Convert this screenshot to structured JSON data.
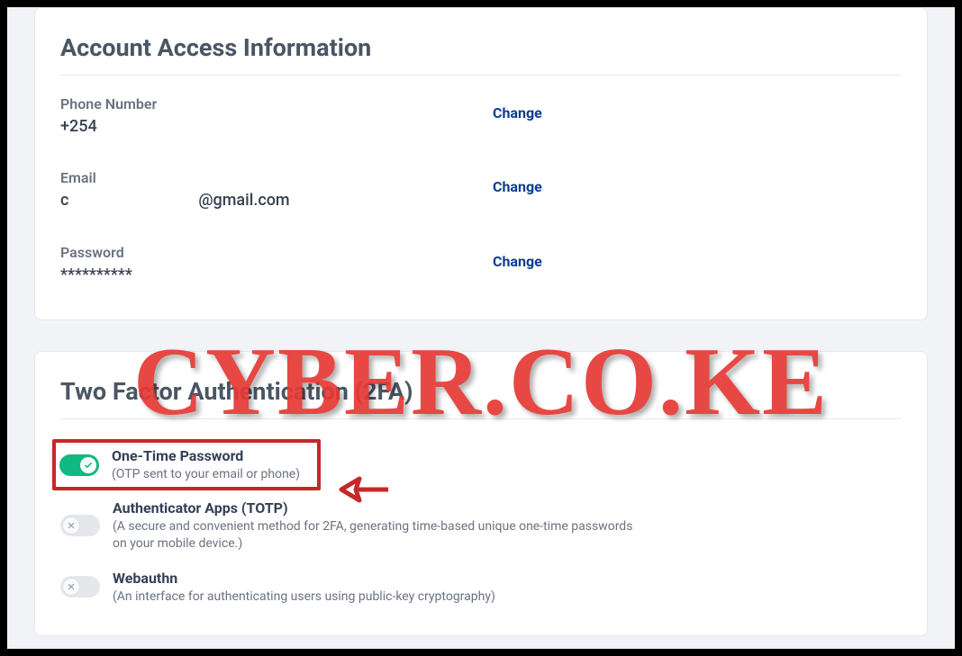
{
  "watermark_text": "CYBER.CO.KE",
  "account": {
    "title": "Account Access Information",
    "phone": {
      "label": "Phone Number",
      "prefix": "+254",
      "action_label": "Change"
    },
    "email": {
      "label": "Email",
      "prefix": "c",
      "suffix": "@gmail.com",
      "action_label": "Change"
    },
    "password": {
      "label": "Password",
      "value": "**********",
      "action_label": "Change"
    }
  },
  "tfa": {
    "title": "Two Factor Authentication (2FA)",
    "options": [
      {
        "enabled": true,
        "title": "One-Time Password",
        "desc": "(OTP sent to your email or phone)"
      },
      {
        "enabled": false,
        "title": "Authenticator Apps (TOTP)",
        "desc": "(A secure and convenient method for 2FA, generating time-based unique one-time passwords on your mobile device.)"
      },
      {
        "enabled": false,
        "title": "Webauthn",
        "desc": "(An interface for authenticating users using public-key cryptography)"
      }
    ]
  }
}
